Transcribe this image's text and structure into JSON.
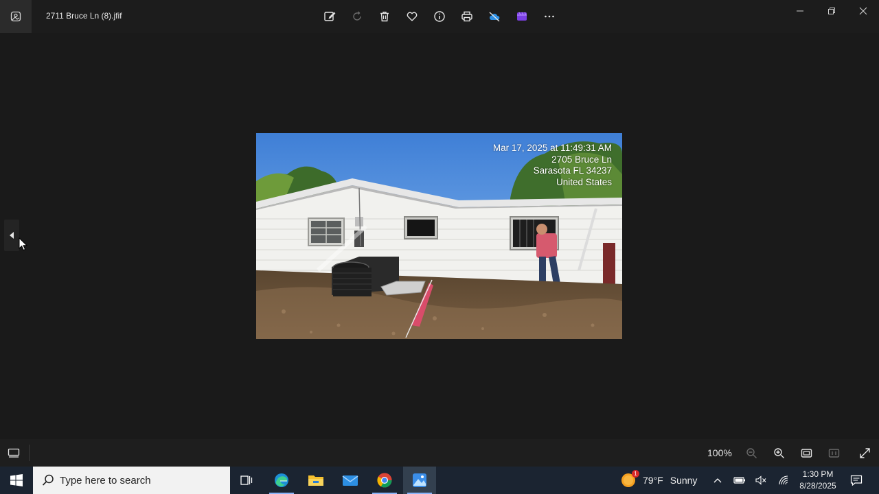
{
  "titlebar": {
    "file_name": "2711 Bruce Ln (8).jfif",
    "toolbar": [
      {
        "name": "edit-image-button",
        "icon": "edit-image-icon"
      },
      {
        "name": "rotate-button",
        "icon": "rotate-icon"
      },
      {
        "name": "delete-button",
        "icon": "trash-icon"
      },
      {
        "name": "favorite-button",
        "icon": "heart-icon"
      },
      {
        "name": "file-info-button",
        "icon": "info-icon"
      },
      {
        "name": "print-button",
        "icon": "printer-icon"
      },
      {
        "name": "onedrive-button",
        "icon": "cloud-off-icon"
      },
      {
        "name": "clipchamp-button",
        "icon": "clipchamp-icon"
      },
      {
        "name": "more-options-button",
        "icon": "ellipsis-icon"
      }
    ],
    "window_controls": [
      "minimize",
      "restore",
      "close"
    ]
  },
  "photo": {
    "stamp_lines": [
      "Mar 17, 2025 at 11:49:31 AM",
      "2705 Bruce Ln",
      "Sarasota FL 34237",
      "United States"
    ]
  },
  "bottombar": {
    "zoom_level": "100%"
  },
  "taskbar": {
    "search_placeholder": "Type here to search",
    "apps": [
      "task-view",
      "edge",
      "file-explorer",
      "mail",
      "chrome",
      "photos"
    ],
    "weather": {
      "temp": "79°F",
      "condition": "Sunny",
      "badge": "1"
    },
    "clock": {
      "time": "1:30 PM",
      "date": "8/28/2025"
    }
  },
  "colors": {
    "viewer_bg": "#1a1a1a",
    "taskbar_bg": "#1b2431",
    "accent": "#8ab4f8"
  }
}
